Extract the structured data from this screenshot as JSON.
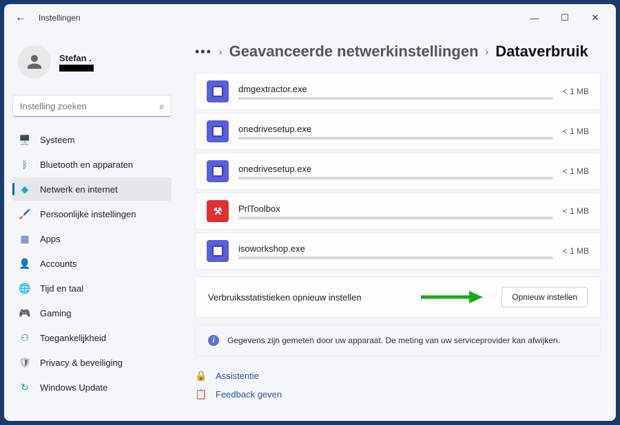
{
  "window": {
    "title": "Instellingen"
  },
  "profile": {
    "name": "Stefan ."
  },
  "search": {
    "placeholder": "Instelling zoeken"
  },
  "nav": {
    "items": [
      {
        "label": "Systeem",
        "icon": "🖥️",
        "color": "#0067c0"
      },
      {
        "label": "Bluetooth en apparaten",
        "icon": "ᛒ",
        "color": "#0067c0"
      },
      {
        "label": "Netwerk en internet",
        "icon": "◆",
        "color": "#00b7c3",
        "active": true
      },
      {
        "label": "Persoonlijke instellingen",
        "icon": "🖌️",
        "color": "#c06000"
      },
      {
        "label": "Apps",
        "icon": "▦",
        "color": "#5060c0"
      },
      {
        "label": "Accounts",
        "icon": "👤",
        "color": "#50a050"
      },
      {
        "label": "Tijd en taal",
        "icon": "🌐",
        "color": "#2080c0"
      },
      {
        "label": "Gaming",
        "icon": "🎮",
        "color": "#888"
      },
      {
        "label": "Toegankelijkheid",
        "icon": "⚇",
        "color": "#3070c0"
      },
      {
        "label": "Privacy & beveiliging",
        "icon": "🛡",
        "color": "#707070"
      },
      {
        "label": "Windows Update",
        "icon": "↻",
        "color": "#2090c0"
      }
    ]
  },
  "breadcrumb": {
    "parent": "Geavanceerde netwerkinstellingen",
    "current": "Dataverbruik"
  },
  "apps": [
    {
      "name": "dmgextractor.exe",
      "size": "< 1 MB",
      "icon": "exe"
    },
    {
      "name": "onedrivesetup.exe",
      "size": "< 1 MB",
      "icon": "exe"
    },
    {
      "name": "onedrivesetup.exe",
      "size": "< 1 MB",
      "icon": "exe"
    },
    {
      "name": "PrlToolbox",
      "size": "< 1 MB",
      "icon": "prl"
    },
    {
      "name": "isoworkshop.exe",
      "size": "< 1 MB",
      "icon": "exe"
    }
  ],
  "reset": {
    "label": "Verbruiksstatistieken opnieuw instellen",
    "button": "Opnieuw instellen"
  },
  "info": {
    "text": "Gegevens zijn gemeten door uw apparaat. De meting van uw serviceprovider kan afwijken."
  },
  "footer": {
    "help": "Assistentie",
    "feedback": "Feedback geven"
  }
}
